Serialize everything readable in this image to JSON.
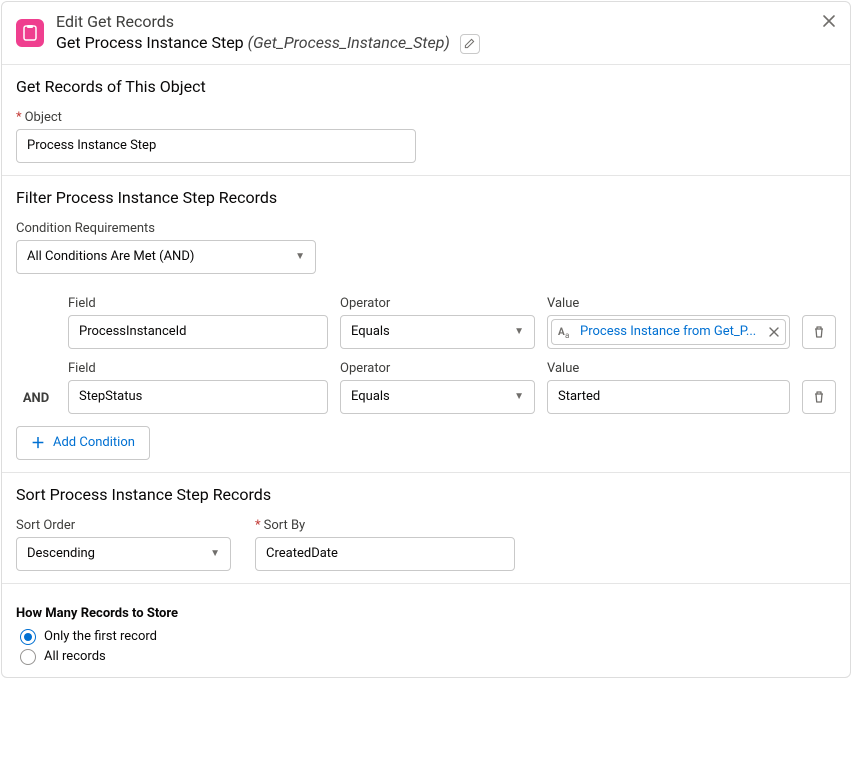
{
  "header": {
    "title": "Edit Get Records",
    "name": "Get Process Instance Step",
    "api_name": "(Get_Process_Instance_Step)"
  },
  "section_object": {
    "title": "Get Records of This Object",
    "object_label": "Object",
    "object_value": "Process Instance Step"
  },
  "section_filter": {
    "title": "Filter Process Instance Step Records",
    "cond_req_label": "Condition Requirements",
    "cond_req_value": "All Conditions Are Met (AND)",
    "labels": {
      "and": "AND",
      "field": "Field",
      "operator": "Operator",
      "value": "Value"
    },
    "rows": [
      {
        "field": "ProcessInstanceId",
        "operator": "Equals",
        "value_pill": "Process Instance from Get_P..."
      },
      {
        "field": "StepStatus",
        "operator": "Equals",
        "value_text": "Started"
      }
    ],
    "add_label": "Add Condition"
  },
  "section_sort": {
    "title": "Sort Process Instance Step Records",
    "order_label": "Sort Order",
    "order_value": "Descending",
    "by_label": "Sort By",
    "by_value": "CreatedDate"
  },
  "section_store": {
    "title": "How Many Records to Store",
    "opt1": "Only the first record",
    "opt2": "All records"
  }
}
